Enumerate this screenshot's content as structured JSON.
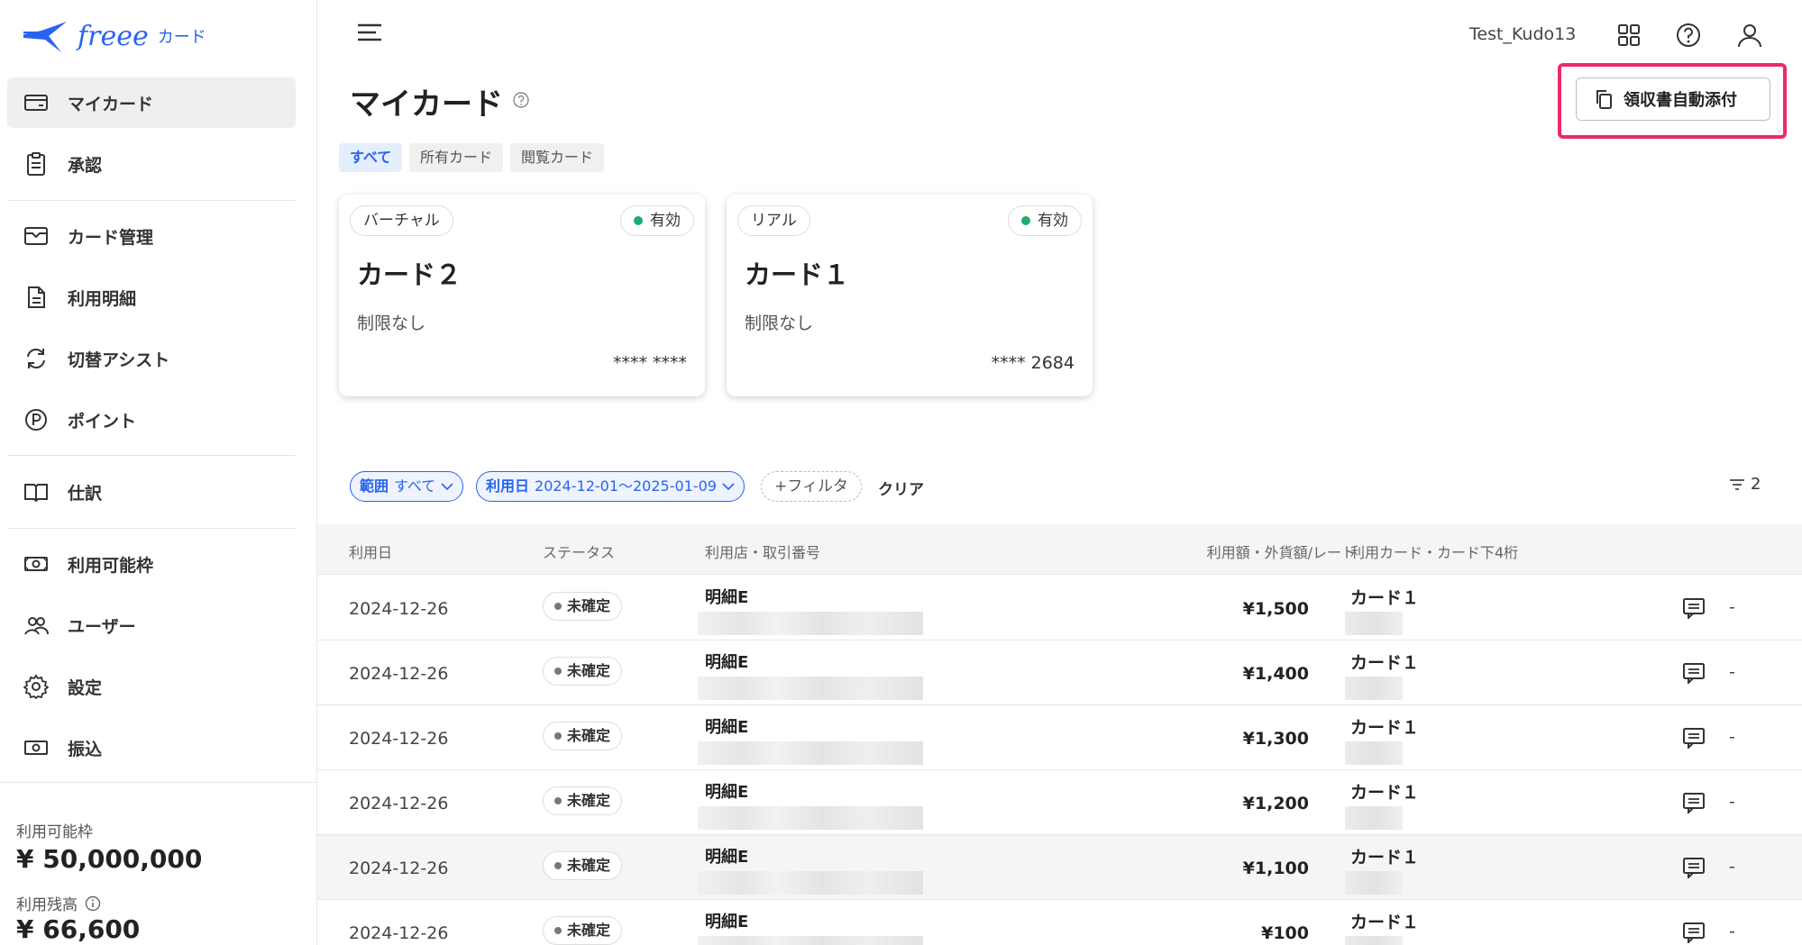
{
  "brand": {
    "name": "freee",
    "sub": "カード"
  },
  "nav": [
    {
      "key": "mycard",
      "label": "マイカード",
      "icon": "card-icon",
      "active": true
    },
    {
      "key": "approval",
      "label": "承認",
      "icon": "clipboard-icon"
    },
    {
      "key": "card-management",
      "label": "カード管理",
      "icon": "card-manage-icon"
    },
    {
      "key": "statement",
      "label": "利用明細",
      "icon": "document-icon"
    },
    {
      "key": "switch-assist",
      "label": "切替アシスト",
      "icon": "refresh-icon"
    },
    {
      "key": "points",
      "label": "ポイント",
      "icon": "point-icon"
    },
    {
      "key": "journal",
      "label": "仕訳",
      "icon": "book-icon"
    },
    {
      "key": "available-limit",
      "label": "利用可能枠",
      "icon": "money-icon"
    },
    {
      "key": "users",
      "label": "ユーザー",
      "icon": "users-icon"
    },
    {
      "key": "settings",
      "label": "設定",
      "icon": "gear-icon"
    },
    {
      "key": "transfer",
      "label": "振込",
      "icon": "money-icon"
    }
  ],
  "sidebar_summary": {
    "available_label": "利用可能枠",
    "available_value": "¥ 50,000,000",
    "balance_label": "利用残高",
    "balance_value": "¥ 66,600"
  },
  "header": {
    "user": "Test_Kudo13"
  },
  "page": {
    "title": "マイカード",
    "receipt_button": "領収書自動添付"
  },
  "tabs": [
    {
      "label": "すべて",
      "active": true
    },
    {
      "label": "所有カード"
    },
    {
      "label": "閲覧カード"
    }
  ],
  "cards": [
    {
      "type": "バーチャル",
      "status": "有効",
      "name": "カード２",
      "limit": "制限なし",
      "number": "**** ****"
    },
    {
      "type": "リアル",
      "status": "有効",
      "name": "カード１",
      "limit": "制限なし",
      "number": "**** 2684"
    }
  ],
  "filters": {
    "range_label": "範囲",
    "range_value": "すべて",
    "date_label": "利用日",
    "date_value": "2024-12-01〜2025-01-09",
    "add_filter": "+フィルタ",
    "clear": "クリア",
    "active_count": "2"
  },
  "table": {
    "headers": {
      "date": "利用日",
      "status": "ステータス",
      "merchant": "利用店・取引番号",
      "amount": "利用額・外貨額/レート",
      "card": "利用カード・カード下4桁"
    },
    "rows": [
      {
        "date": "2024-12-26",
        "status": "未確定",
        "merchant": "明細E",
        "amount": "¥1,500",
        "card": "カード１",
        "memo": "-"
      },
      {
        "date": "2024-12-26",
        "status": "未確定",
        "merchant": "明細E",
        "amount": "¥1,400",
        "card": "カード１",
        "memo": "-"
      },
      {
        "date": "2024-12-26",
        "status": "未確定",
        "merchant": "明細E",
        "amount": "¥1,300",
        "card": "カード１",
        "memo": "-"
      },
      {
        "date": "2024-12-26",
        "status": "未確定",
        "merchant": "明細E",
        "amount": "¥1,200",
        "card": "カード１",
        "memo": "-"
      },
      {
        "date": "2024-12-26",
        "status": "未確定",
        "merchant": "明細E",
        "amount": "¥1,100",
        "card": "カード１",
        "memo": "-",
        "shaded": true
      },
      {
        "date": "2024-12-26",
        "status": "未確定",
        "merchant": "明細E",
        "amount": "¥100",
        "card": "カード１",
        "memo": "-"
      }
    ]
  },
  "colors": {
    "accent": "#2864f0",
    "highlight": "#ea2a6a",
    "active_green": "#1aae6f"
  }
}
